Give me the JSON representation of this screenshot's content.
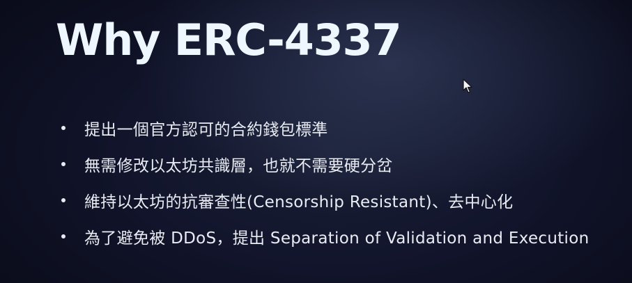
{
  "slide": {
    "title": "Why ERC-4337",
    "bullets": [
      "提出一個官方認可的合約錢包標準",
      "無需修改以太坊共識層，也就不需要硬分岔",
      "維持以太坊的抗審查性(Censorship Resistant)、去中心化",
      "為了避免被 DDoS，提出 Separation of Validation and Execution"
    ]
  },
  "colors": {
    "background_dark": "#0b0d1a",
    "background_highlight": "#465478",
    "title_text": "#eef7ff",
    "body_text": "#e9ecf3"
  },
  "icons": {
    "cursor": "mouse-pointer-icon",
    "bullet": "bullet-dot-icon"
  }
}
